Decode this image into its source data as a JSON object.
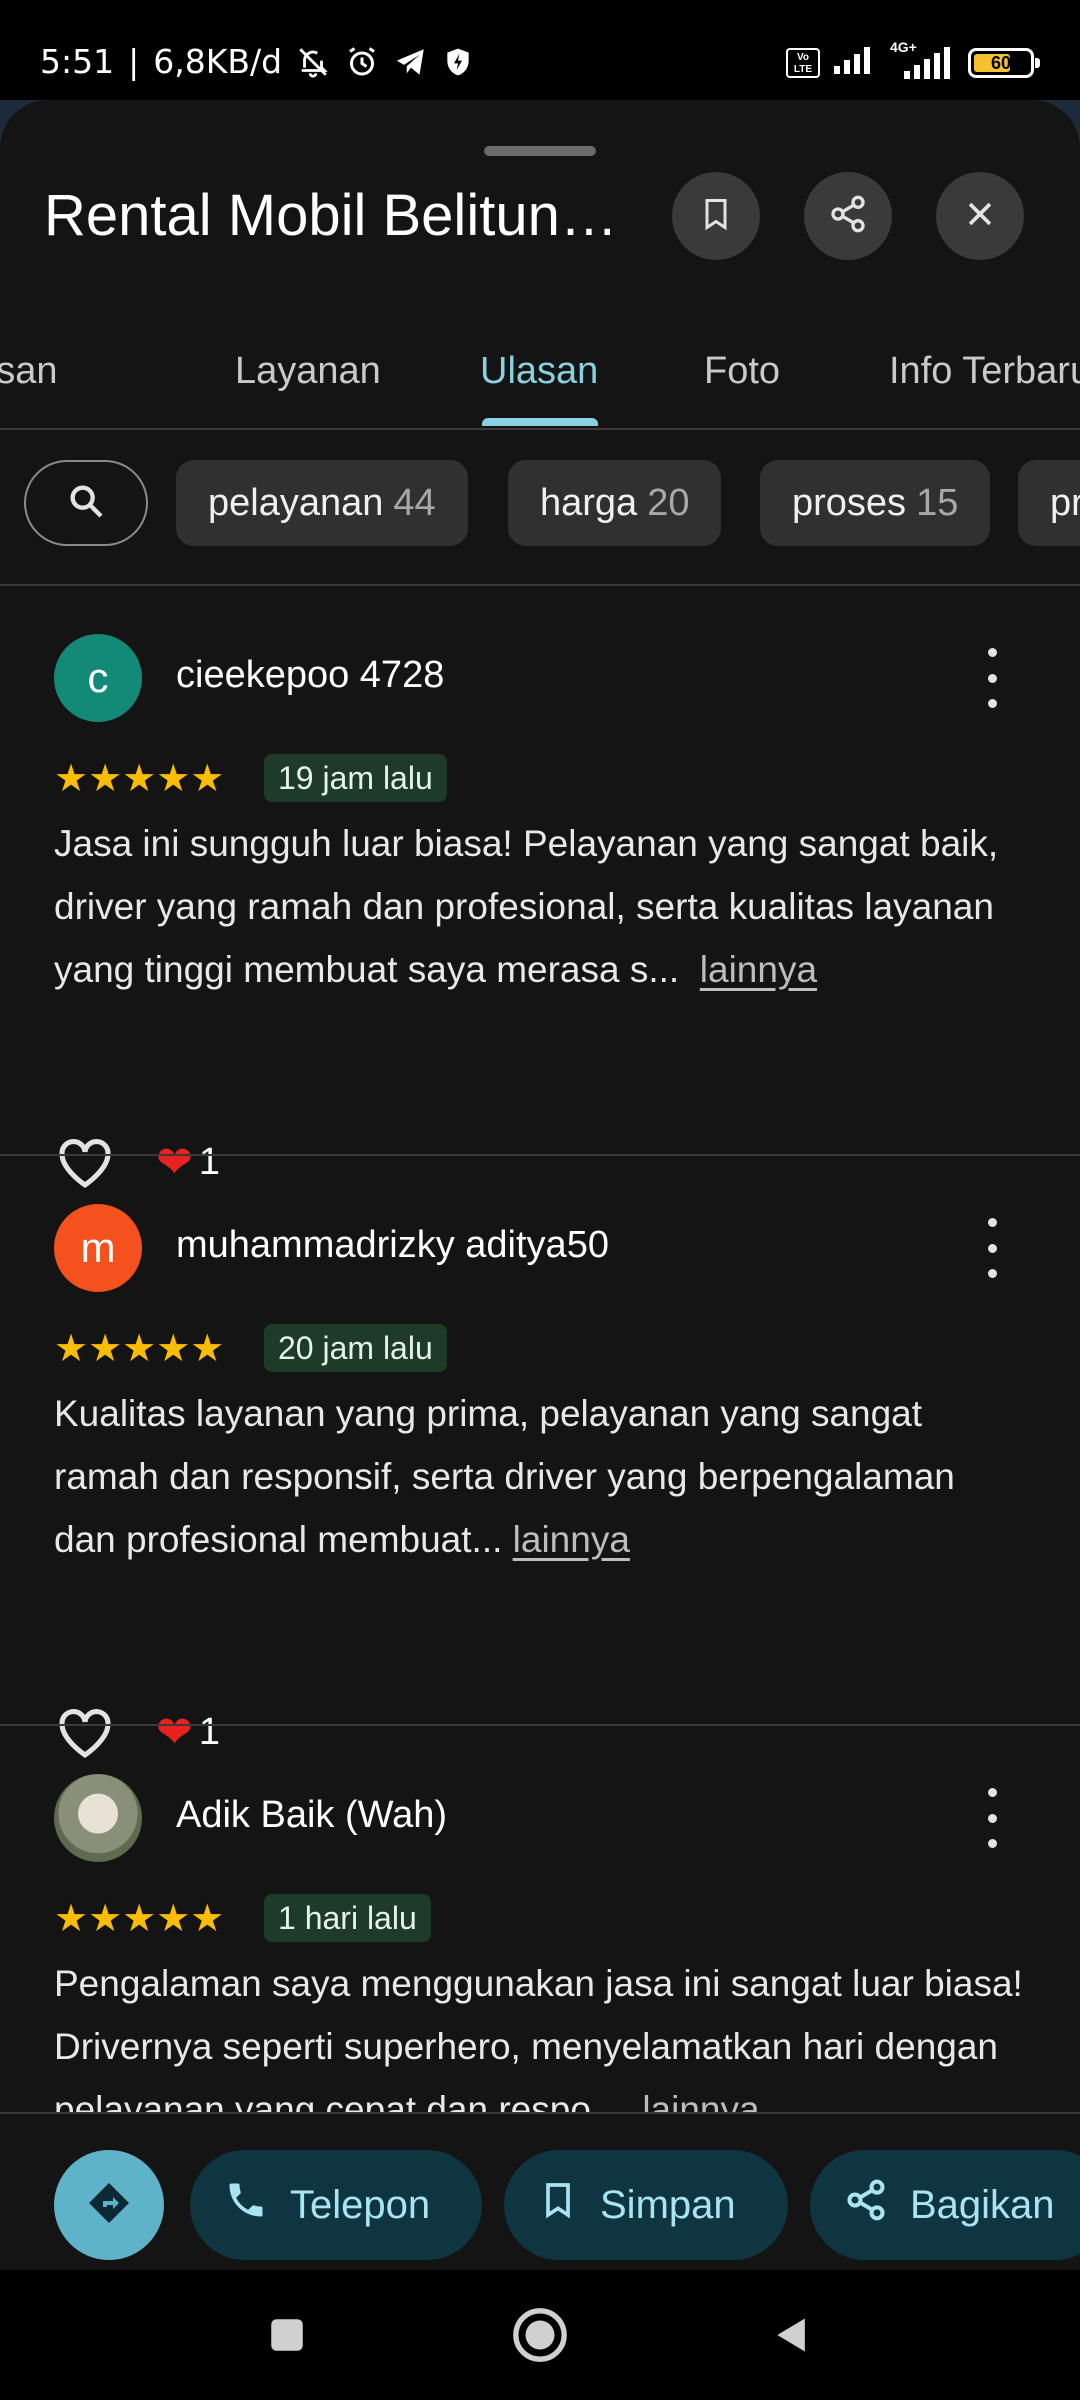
{
  "status_bar": {
    "time": "5:51",
    "separator": "|",
    "data_speed": "6,8KB/d",
    "network_badge": "4G+",
    "volte_label": "Vo LTE",
    "battery_level": "60",
    "icons": [
      "bell-off-icon",
      "alarm-icon",
      "telegram-icon",
      "shield-bolt-icon",
      "volte-icon",
      "signal-icon",
      "signal-4g-icon",
      "battery-icon"
    ]
  },
  "header": {
    "title": "Rental Mobil Belitung Baru",
    "icons": [
      "bookmark-icon",
      "share-icon",
      "close-icon"
    ]
  },
  "tabs": [
    "Ringkasan",
    "Layanan",
    "Ulasan",
    "Foto",
    "Info Terbaru"
  ],
  "active_tab": "Ulasan",
  "chips": [
    {
      "label": "pelayanan",
      "count": "44"
    },
    {
      "label": "harga",
      "count": "20"
    },
    {
      "label": "proses",
      "count": "15"
    },
    {
      "label": "profesional",
      "count": ""
    }
  ],
  "reviews": [
    {
      "avatar_letter": "c",
      "avatar_color": "#138a77",
      "name": "cieekepoo 4728",
      "stars": "★★★★★",
      "rating": 5,
      "time": "19 jam lalu",
      "text": "Jasa ini sungguh luar biasa! Pelayanan yang sangat baik, driver yang ramah dan profesional, serta kualitas layanan yang tinggi membuat saya merasa s...",
      "more": "lainnya",
      "heart_emoji": "❤",
      "likes": "1"
    },
    {
      "avatar_letter": "m",
      "avatar_color": "#f4511e",
      "name": "muhammadrizky aditya50",
      "stars": "★★★★★",
      "rating": 5,
      "time": "20 jam lalu",
      "text": "Kualitas layanan yang prima, pelayanan yang sangat ramah dan responsif, serta driver yang berpengalaman dan profesional membuat...",
      "more": "lainnya",
      "heart_emoji": "❤",
      "likes": "1"
    },
    {
      "avatar_letter": "",
      "avatar_color": "#8a8f7a",
      "name": "Adik Baik (Wah)",
      "stars": "★★★★★",
      "rating": 5,
      "time": "1 hari lalu",
      "text": "Pengalaman saya menggunakan jasa ini sangat luar biasa! Drivernya seperti superhero, menyelamatkan hari dengan pelayanan yang cepat dan respo...",
      "more": "lainnya"
    }
  ],
  "action_bar": {
    "buttons": [
      "Telepon",
      "Simpan",
      "Bagikan"
    ],
    "icons": [
      "directions-icon",
      "phone-icon",
      "bookmark-icon",
      "share-icon"
    ]
  },
  "nav_bar": {
    "icons": [
      "recents-square-icon",
      "home-circle-icon",
      "back-triangle-icon"
    ]
  },
  "colors": {
    "accent": "#8ad1e0",
    "star": "#fbbc04",
    "sheet_bg": "#141414",
    "chip_bg": "#303030",
    "time_badge_bg": "#1e3b27",
    "action_button_bg": "#0f3640"
  }
}
